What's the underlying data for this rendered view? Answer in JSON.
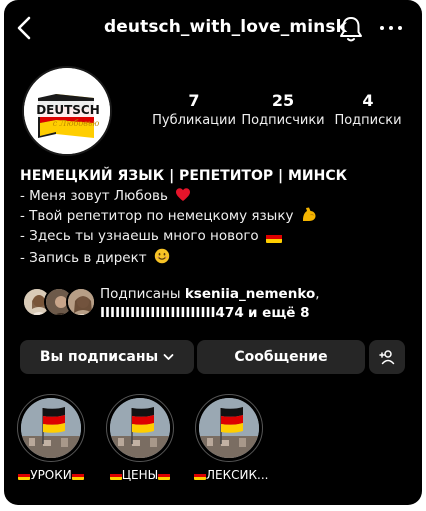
{
  "header": {
    "username": "deutsch_with_love_minsk",
    "back_icon": "chevron-left-icon",
    "bell_icon": "bell-icon",
    "more_icon": "more-horizontal-icon"
  },
  "avatar": {
    "logo_text": "DEUTSCH",
    "logo_script": "с Любовью",
    "logo_colors": [
      "#000000",
      "#dd0000",
      "#ffce00"
    ]
  },
  "stats": [
    {
      "value": "7",
      "label": "Публикации"
    },
    {
      "value": "25",
      "label": "Подписчики"
    },
    {
      "value": "4",
      "label": "Подписки"
    }
  ],
  "bio": {
    "title": "НЕМЕЦКИЙ ЯЗЫК | РЕПЕТИТОР | МИНСК",
    "lines": [
      "- Меня зовут Любовь",
      "- Твой репетитор по немецкому языку",
      "- Здесь ты узнаешь много нового",
      "- Запись в директ"
    ],
    "line_icons": [
      "red-heart-icon",
      "flexed-biceps-icon",
      "german-flag-icon",
      "smiling-face-icon"
    ]
  },
  "followed_by": {
    "prefix": "Подписаны",
    "user": "kseniia_nemenko",
    "suffix": ",",
    "second_user": "IIIIIIIIIIIIIIIIIIIIIII474",
    "tail": "и ещё 8"
  },
  "buttons": {
    "following": "Вы подписаны",
    "message": "Сообщение",
    "add_user_icon": "add-person-icon"
  },
  "highlights": [
    {
      "label": "УРОКИ"
    },
    {
      "label": "ЦЕНЫ"
    },
    {
      "label": "ЛЕКСИК..."
    }
  ],
  "colors": {
    "background": "#000000",
    "button": "#262626",
    "text": "#f5f5f5"
  }
}
